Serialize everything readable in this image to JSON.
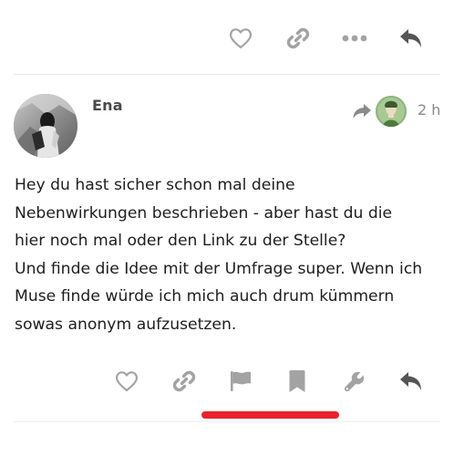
{
  "previous_post": {
    "actions": {
      "like_icon": "heart-outline",
      "link_icon": "link",
      "more_icon": "ellipsis",
      "reply_icon": "reply-arrow"
    }
  },
  "post": {
    "username": "Ena",
    "reply_to_icon": "share-arrow",
    "time": "2 h",
    "body_lines": [
      "Hey du hast sicher schon mal deine",
      "Nebenwirkungen beschrieben - aber hast du die",
      "hier noch mal oder den Link zu der Stelle?",
      "Und finde die Idee mit der Umfrage super. Wenn ich",
      "Muse finde würde ich mich auch drum kümmern",
      "sowas anonym aufzusetzen."
    ],
    "actions": {
      "like_icon": "heart-outline",
      "link_icon": "link",
      "flag_icon": "flag",
      "bookmark_icon": "bookmark",
      "admin_icon": "wrench",
      "reply_icon": "reply-arrow"
    }
  },
  "colors": {
    "icon_gray": "#a3a3a3",
    "icon_dark": "#555555",
    "highlight_red": "#e8232c",
    "divider": "#e6e6e6"
  }
}
